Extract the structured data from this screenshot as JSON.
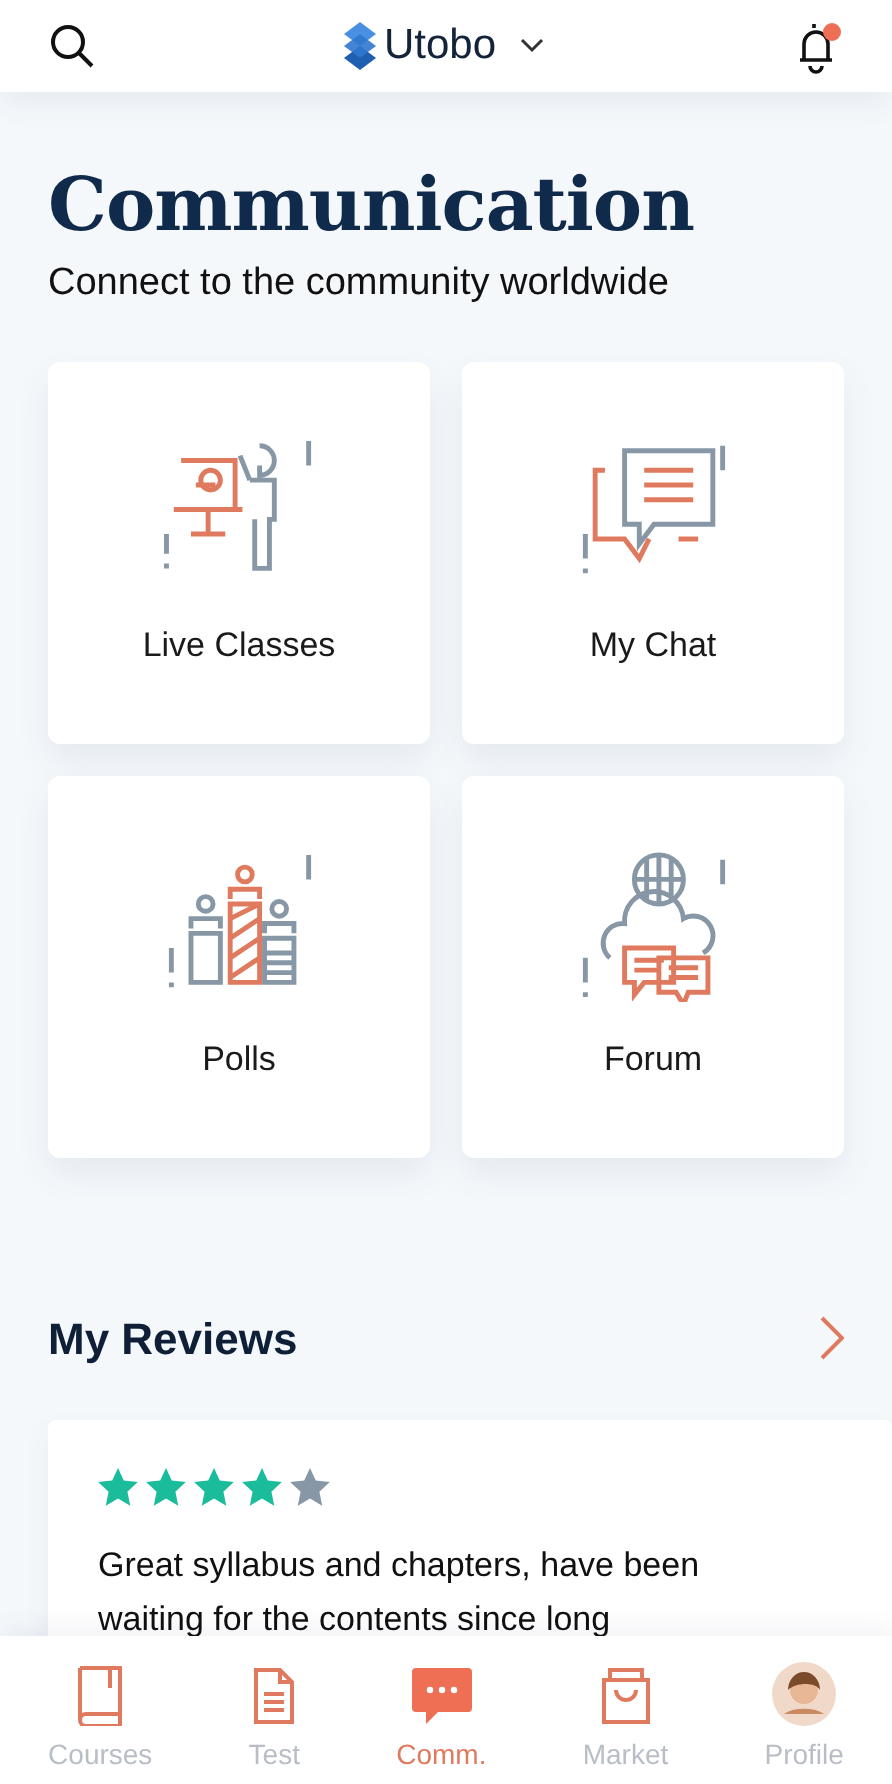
{
  "header": {
    "brand": "Utobo",
    "notification_dot": true
  },
  "title": "Communication",
  "subtitle": "Connect to the community worldwide",
  "features": [
    {
      "label": "Live Classes",
      "kind": "presenter"
    },
    {
      "label": "My Chat",
      "kind": "chat"
    },
    {
      "label": "Polls",
      "kind": "polls"
    },
    {
      "label": "Forum",
      "kind": "forum"
    }
  ],
  "reviews": {
    "title": "My Reviews",
    "items": [
      {
        "stars": 4,
        "text": "Great syllabus and chapters, have been waiting for the contents since long"
      }
    ]
  },
  "tabs": [
    {
      "label": "Courses",
      "kind": "book",
      "selected": false
    },
    {
      "label": "Test",
      "kind": "document",
      "selected": false
    },
    {
      "label": "Comm.",
      "kind": "chat",
      "selected": true
    },
    {
      "label": "Market",
      "kind": "bag",
      "selected": false
    },
    {
      "label": "Profile",
      "kind": "avatar",
      "selected": false
    }
  ]
}
